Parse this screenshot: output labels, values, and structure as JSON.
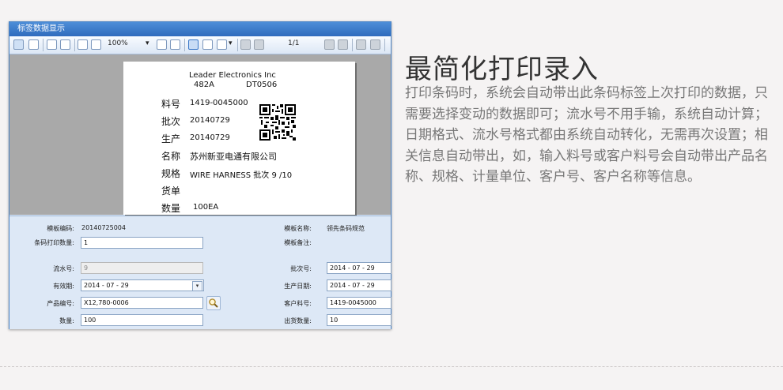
{
  "window": {
    "title": "标签数据显示"
  },
  "toolbar": {
    "zoom": "100%",
    "page": "1/1"
  },
  "label_preview": {
    "company": "Leader  Electronics  Inc",
    "code_a": "482A",
    "code_b": "DT0506",
    "rows": [
      {
        "key": "料号",
        "value": "1419-0045000"
      },
      {
        "key": "批次",
        "value": "20140729"
      },
      {
        "key": "生产",
        "value": "20140729"
      },
      {
        "key": "名称",
        "value": "苏州新亚电通有限公司"
      },
      {
        "key": "规格",
        "value": "WIRE HARNESS  批次 9  /10"
      },
      {
        "key": "货单",
        "value": ""
      },
      {
        "key": "数量",
        "value": "100EA"
      }
    ]
  },
  "form": {
    "template_code_label": "模板编码:",
    "template_code": "20140725004",
    "template_name_label": "模板名称:",
    "template_name": "领先条码规范",
    "print_qty_label": "条码打印数量:",
    "print_qty": "1",
    "template_note_label": "模板备注:",
    "serial_label": "流水号:",
    "serial": "9",
    "batch_label": "批次号:",
    "batch": "2014 - 07 - 29",
    "expiry_label": "有效期:",
    "expiry": "2014 - 07 - 29",
    "prod_date_label": "生产日期:",
    "prod_date": "2014 - 07 - 29",
    "product_code_label": "产品编号:",
    "product_code": "X12,780-0006",
    "customer_part_label": "客户料号:",
    "customer_part": "1419-0045000",
    "qty_label": "数量:",
    "qty": "100",
    "ship_qty_label": "出货数量:",
    "ship_qty": "10"
  },
  "content": {
    "heading": "最简化打印录入",
    "paragraph": "打印条码时，系统会自动带出此条码标签上次打印的数据，只需要选择变动的数据即可；流水号不用手输，系统自动计算；日期格式、流水号格式都由系统自动转化，无需再次设置；相关信息自动带出，如，输入料号或客户料号会自动带出产品名称、规格、计量单位、客户号、客户名称等信息。"
  },
  "colors": {
    "window_border": "#4f86c6",
    "heading": "#333333",
    "paragraph": "#777777"
  }
}
